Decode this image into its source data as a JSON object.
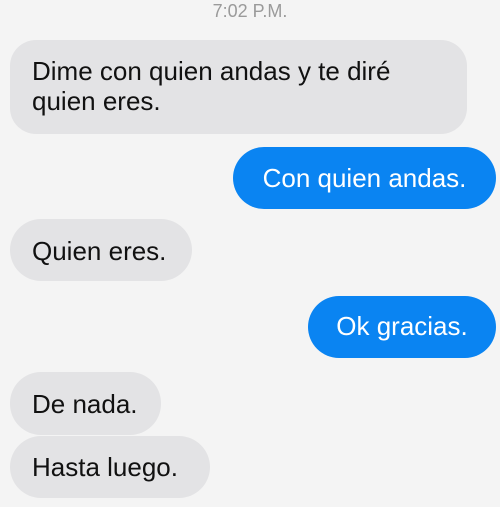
{
  "conversation": {
    "timestamp": "7:02 P.M.",
    "messages": [
      {
        "direction": "incoming",
        "text": "Dime con quien andas y te diré quien eres."
      },
      {
        "direction": "outgoing",
        "text": "Con quien andas."
      },
      {
        "direction": "incoming",
        "text": "Quien eres."
      },
      {
        "direction": "outgoing",
        "text": "Ok gracias."
      },
      {
        "direction": "incoming",
        "text": "De nada."
      },
      {
        "direction": "incoming",
        "text": "Hasta luego."
      }
    ]
  },
  "colors": {
    "background": "#f4f4f4",
    "incoming_bubble": "#e3e3e5",
    "outgoing_bubble": "#0a84f2",
    "timestamp_text": "#9a9a9a"
  }
}
